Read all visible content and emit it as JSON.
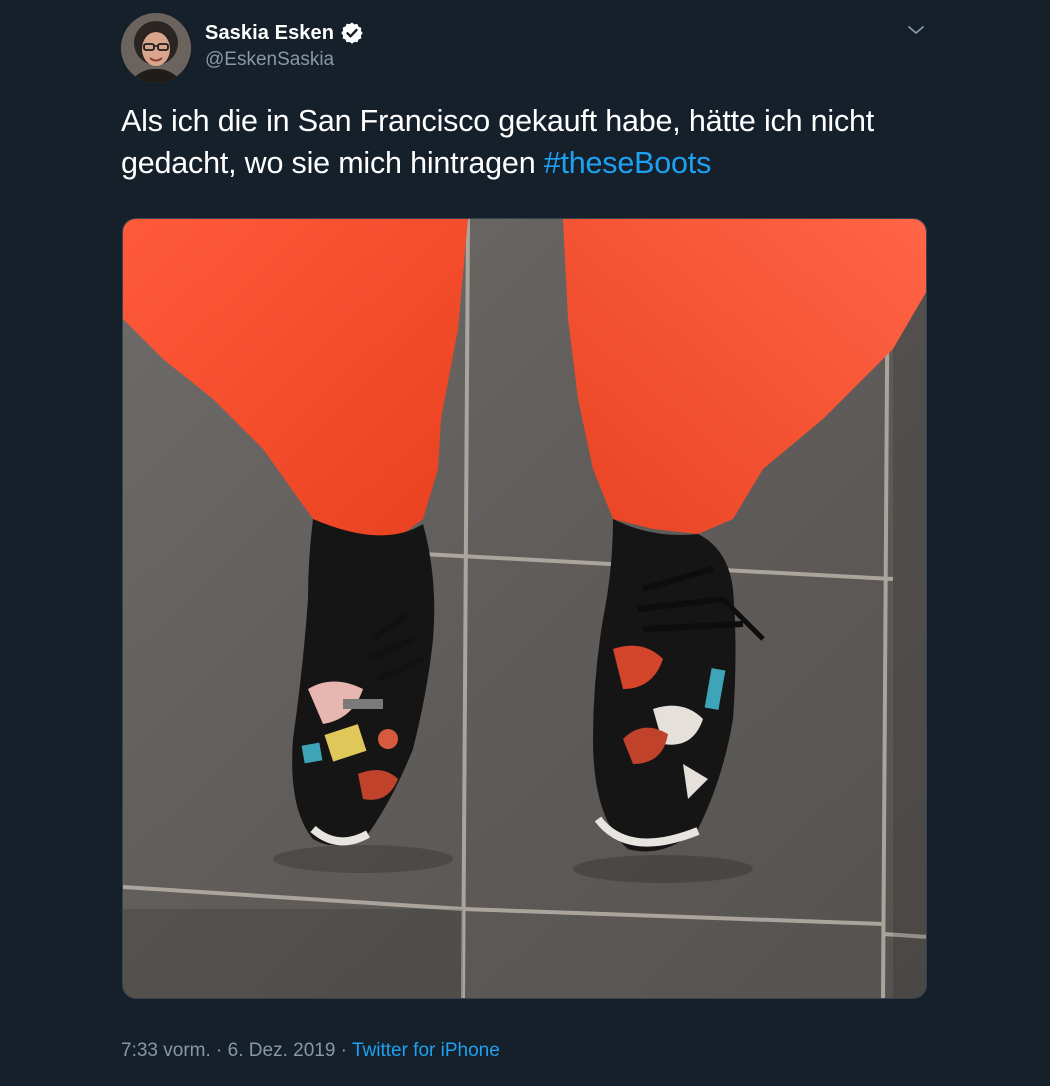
{
  "user": {
    "display_name": "Saskia Esken",
    "handle": "@EskenSaskia",
    "verified": true
  },
  "tweet": {
    "text": "Als ich die in San Francisco gekauft habe, hätte ich nicht gedacht, wo sie mich hintragen ",
    "hashtag": "#theseBoots"
  },
  "meta": {
    "time": "7:33 vorm.",
    "separator1": " · ",
    "date": "6. Dez. 2019",
    "separator2": " · ",
    "source": "Twitter for iPhone"
  },
  "colors": {
    "background": "#15202b",
    "text_primary": "#ffffff",
    "text_secondary": "#8899a6",
    "accent": "#1da1f2"
  },
  "icons": {
    "verified": "verified-badge-icon",
    "caret": "chevron-down-icon"
  }
}
